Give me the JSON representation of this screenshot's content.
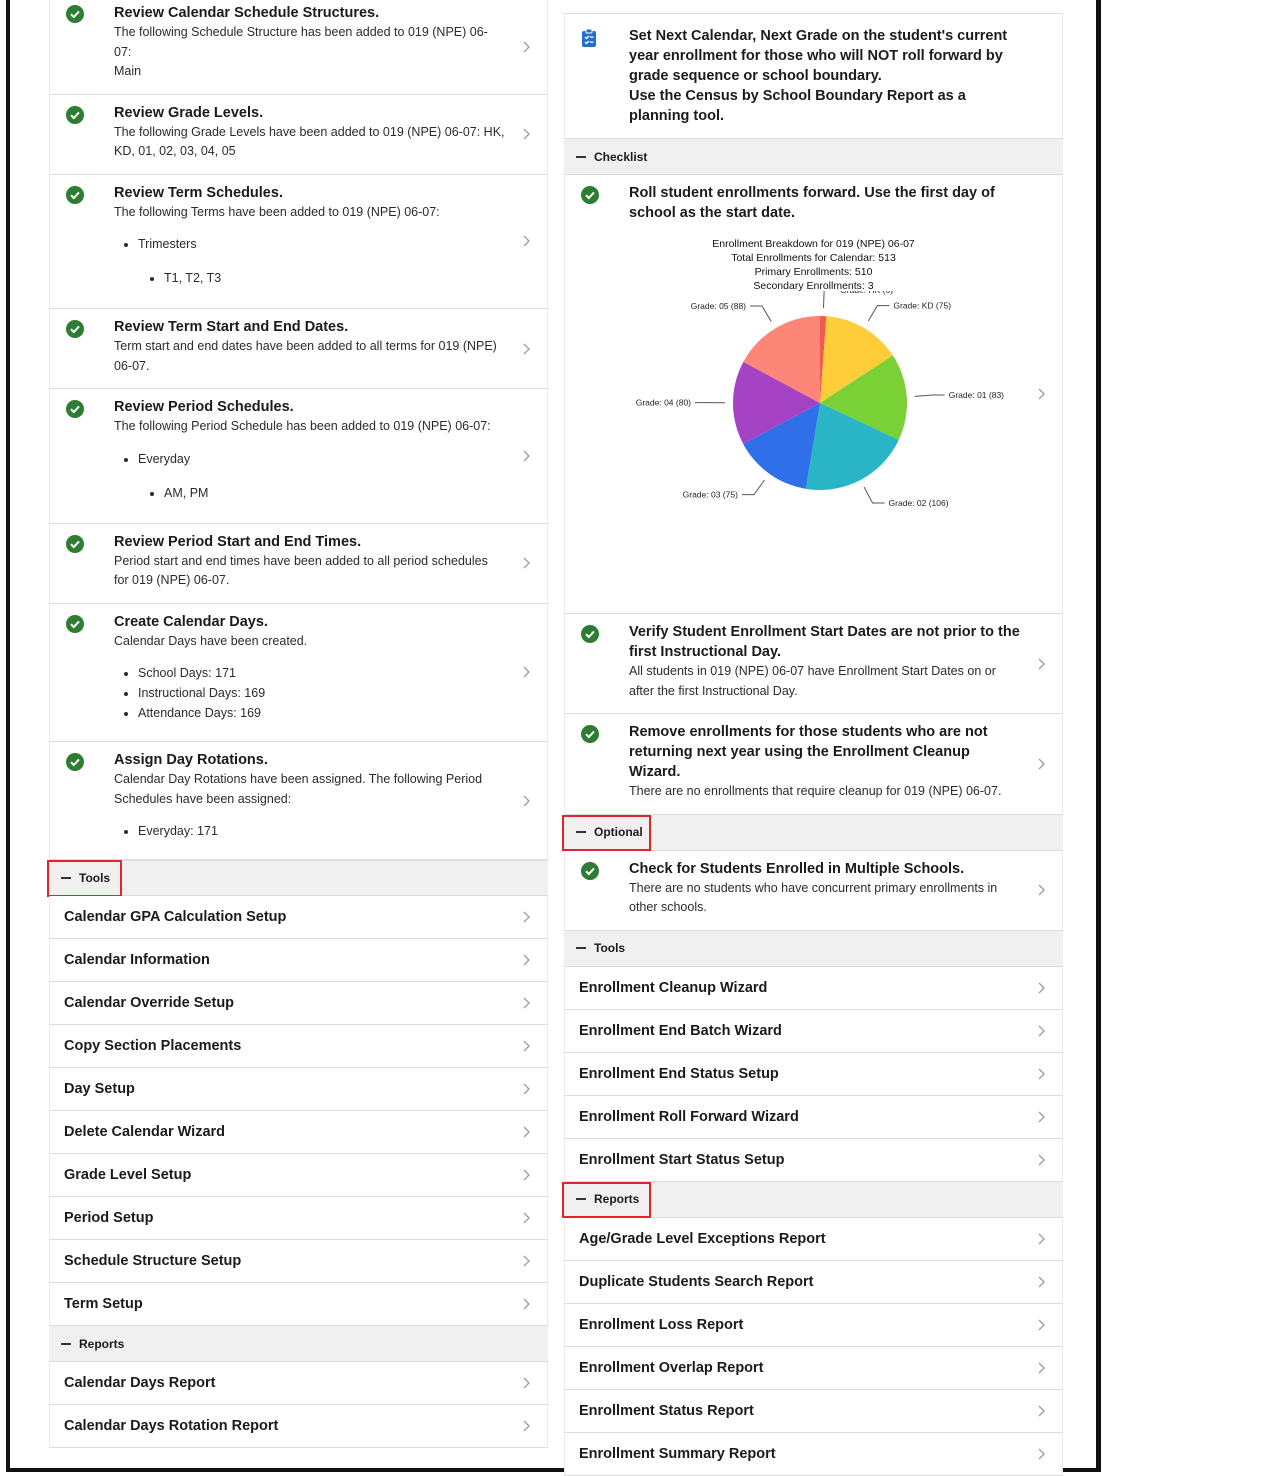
{
  "left": {
    "tasks": [
      {
        "title": "Review Calendar Schedule Structures.",
        "desc": [
          "The following Schedule Structure has been added to 019 (NPE) 06-07:",
          "Main"
        ]
      },
      {
        "title": "Review Grade Levels.",
        "desc": [
          "The following Grade Levels have been added to 019 (NPE) 06-07: HK, KD, 01, 02, 03, 04, 05"
        ]
      },
      {
        "title": "Review Term Schedules.",
        "desc": [
          "The following Terms have been added to 019 (NPE) 06-07:"
        ],
        "list": [
          "Trimesters"
        ],
        "sublist": [
          "T1, T2, T3"
        ]
      },
      {
        "title": "Review Term Start and End Dates.",
        "desc": [
          "Term start and end dates have been added to all terms for 019 (NPE) 06-07."
        ]
      },
      {
        "title": "Review Period Schedules.",
        "desc": [
          "The following Period Schedule has been added to 019 (NPE) 06-07:"
        ],
        "list": [
          "Everyday"
        ],
        "sublist": [
          "AM, PM"
        ]
      },
      {
        "title": "Review Period Start and End Times.",
        "desc": [
          "Period start and end times have been added to all period schedules for 019 (NPE) 06-07."
        ]
      },
      {
        "title": "Create Calendar Days.",
        "desc": [
          "Calendar Days have been created."
        ],
        "flat": [
          "School Days: 171",
          "Instructional Days: 169",
          "Attendance Days: 169"
        ]
      },
      {
        "title": "Assign Day Rotations.",
        "desc": [
          "Calendar Day Rotations have been assigned. The following Period Schedules have been assigned:"
        ],
        "flat": [
          "Everyday: 171"
        ]
      }
    ],
    "tools_header": "Tools",
    "tools": [
      "Calendar GPA Calculation Setup",
      "Calendar Information",
      "Calendar Override Setup",
      "Copy Section Placements",
      "Day Setup",
      "Delete Calendar Wizard",
      "Grade Level Setup",
      "Period Setup",
      "Schedule Structure Setup",
      "Term Setup"
    ],
    "reports_header": "Reports",
    "reports": [
      "Calendar Days Report",
      "Calendar Days Rotation Report"
    ]
  },
  "right": {
    "intro_lines": [
      "Set Next Calendar, Next Grade on the student's current year enrollment for those who will NOT roll forward by grade sequence or school boundary.",
      "Use the Census by School Boundary Report as a planning tool."
    ],
    "checklist_header": "Checklist",
    "roll_task": {
      "title": "Roll student enrollments forward. Use the first day of school as the start date."
    },
    "verify_task": {
      "title": "Verify Student Enrollment Start Dates are not prior to the first Instructional Day.",
      "desc": "All students in 019 (NPE) 06-07 have Enrollment Start Dates on or after the first Instructional Day."
    },
    "remove_task": {
      "title": "Remove enrollments for those students who are not returning next year using the Enrollment Cleanup Wizard.",
      "desc": "There are no enrollments that require cleanup for 019 (NPE) 06-07."
    },
    "optional_header": "Optional",
    "multi_task": {
      "title": "Check for Students Enrolled in Multiple Schools.",
      "desc": "There are no students who have concurrent primary enrollments in other schools."
    },
    "tools_header": "Tools",
    "tools": [
      "Enrollment Cleanup Wizard",
      "Enrollment End Batch Wizard",
      "Enrollment End Status Setup",
      "Enrollment Roll Forward Wizard",
      "Enrollment Start Status Setup"
    ],
    "reports_header": "Reports",
    "reports": [
      "Age/Grade Level Exceptions Report",
      "Duplicate Students Search Report",
      "Enrollment Loss Report",
      "Enrollment Overlap Report",
      "Enrollment Status Report",
      "Enrollment Summary Report"
    ]
  },
  "chart_data": {
    "type": "pie",
    "header_lines": [
      "Enrollment Breakdown for 019 (NPE) 06-07",
      "Total Enrollments for Calendar: 513",
      "Primary Enrollments: 510",
      "Secondary Enrollments: 3"
    ],
    "slices": [
      {
        "label": "Grade: HK (6)",
        "value": 6,
        "color": "#f05a4f"
      },
      {
        "label": "Grade: KD (75)",
        "value": 75,
        "color": "#ffcc3a"
      },
      {
        "label": "Grade: 01 (83)",
        "value": 83,
        "color": "#7ad135"
      },
      {
        "label": "Grade: 02 (106)",
        "value": 106,
        "color": "#2ab5c7"
      },
      {
        "label": "Grade: 03 (75)",
        "value": 75,
        "color": "#2f6fe8"
      },
      {
        "label": "Grade: 04 (80)",
        "value": 80,
        "color": "#a642c4"
      },
      {
        "label": "Grade: 05 (88)",
        "value": 88,
        "color": "#fc8678"
      }
    ]
  },
  "colors": {
    "check": "#2e7d32",
    "highlight": "#e0242a",
    "section_bg": "#f0f0f0",
    "clipboard": "#1f6fd1"
  }
}
